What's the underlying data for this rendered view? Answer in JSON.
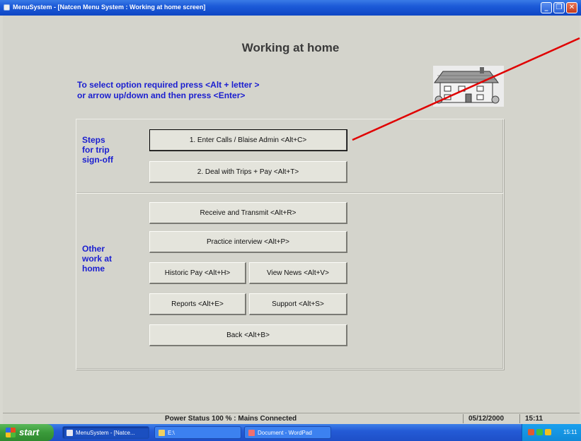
{
  "window": {
    "title": "MenuSystem - [Natcen Menu System : Working at home screen]",
    "minimize": "_",
    "restore": "❐",
    "close": "✕"
  },
  "main": {
    "heading": "Working at home",
    "instructions_line1": "To select option required press <Alt + letter >",
    "instructions_line2": "or arrow up/down and then press <Enter>"
  },
  "section_steps": {
    "label_line1": "Steps",
    "label_line2": "for trip",
    "label_line3": "sign-off",
    "enter_calls": "1.    Enter Calls / Blaise Admin <Alt+C>",
    "deal_trips": "2.   Deal with Trips + Pay <Alt+T>"
  },
  "section_other": {
    "label_line1": "Other",
    "label_line2": "work at",
    "label_line3": "home",
    "receive_transmit": "Receive and Transmit    <Alt+R>",
    "practice_interview": "Practice interview <Alt+P>",
    "historic_pay": "Historic Pay <Alt+H>",
    "view_news": "View News <Alt+V>",
    "reports": "Reports <Alt+E>",
    "support": "Support <Alt+S>",
    "back": "Back <Alt+B>"
  },
  "statusbar": {
    "power": "Power Status 100 % : Mains Connected",
    "date": "05/12/2000",
    "time": "15:11"
  },
  "taskbar": {
    "start": "start",
    "tasks": [
      "MenuSystem - [Natce...",
      "E:\\",
      "Document - WordPad"
    ],
    "clock": "15:11"
  },
  "colors": {
    "instruction_text": "#1a1ed0",
    "annotation_arrow": "#e00000"
  }
}
